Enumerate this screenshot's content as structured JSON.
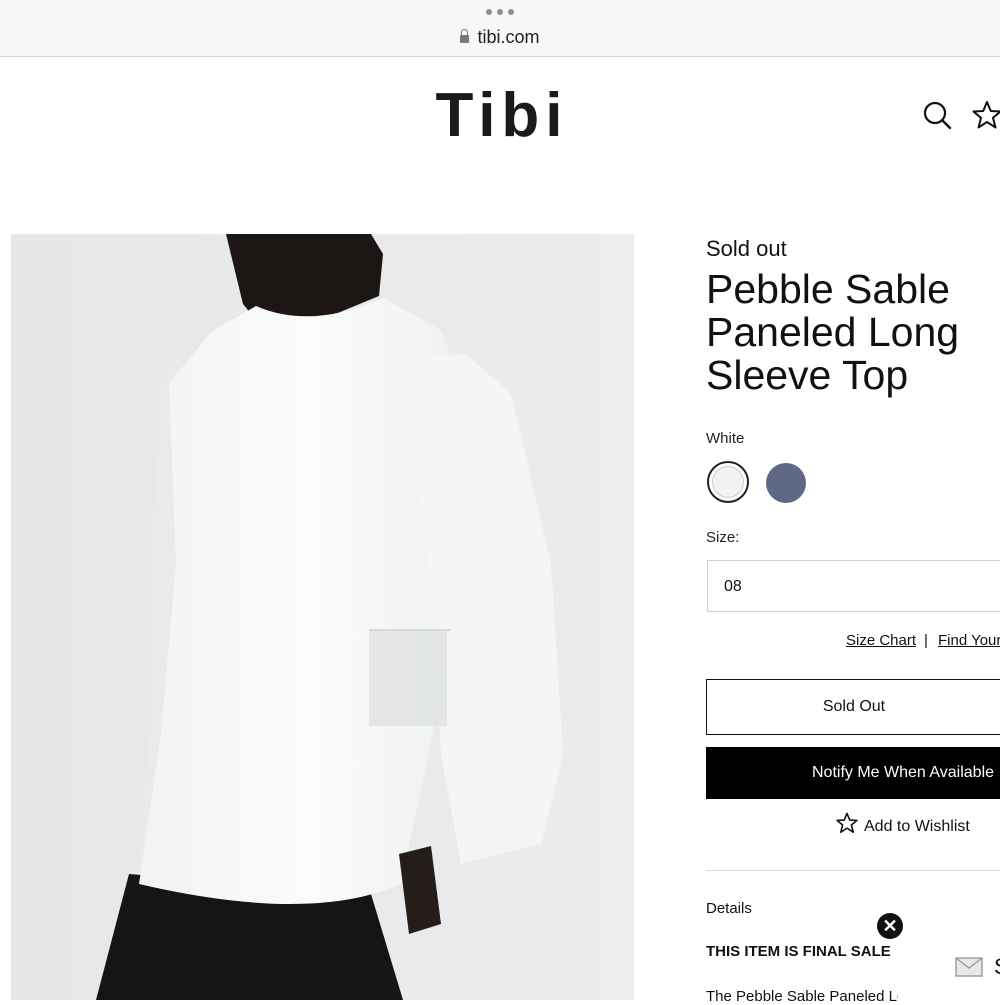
{
  "browser": {
    "url": "tibi.com",
    "icons": [
      "more-dots-icon",
      "lock-icon"
    ]
  },
  "header": {
    "logo": "Tibi",
    "icons": [
      "search-icon",
      "star-icon"
    ]
  },
  "product": {
    "status": "Sold out",
    "title": "Pebble Sable Paneled Long Sleeve Top",
    "color_label": "White",
    "swatches": [
      {
        "name": "White",
        "color": "#ffffff",
        "selected": true
      },
      {
        "name": "Slate",
        "color": "#5f6985",
        "selected": false
      }
    ],
    "size_label": "Size:",
    "size_value": "08",
    "size_chart_link": "Size Chart",
    "separator": "|",
    "find_size_link": "Find Your",
    "sold_out_button": "Sold Out",
    "notify_button": "Notify Me When Available",
    "wishlist_label": "Add to Wishlist",
    "details_label": "Details",
    "final_sale": "THIS ITEM IS FINAL SALE",
    "description": "The Pebble Sable Paneled Lc"
  },
  "popup": {
    "close_symbol": "✕",
    "icon": "envelope-icon",
    "label_fragment": "S"
  },
  "colors": {
    "accent": "#000000",
    "photo_bg": "#e8e9ea"
  }
}
